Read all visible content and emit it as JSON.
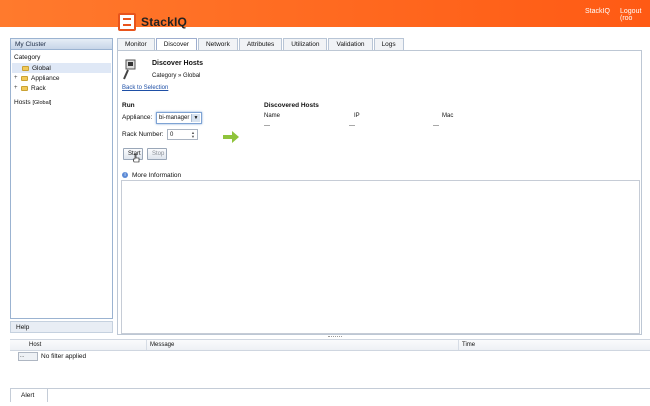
{
  "header": {
    "app_name": "StackIQ",
    "link_stackiq": "StackIQ",
    "link_logout": "Logout (roo"
  },
  "sidebar": {
    "title": "My Cluster",
    "category_label": "Category",
    "tree": [
      {
        "label": "Global",
        "selected": true
      },
      {
        "label": "Appliance",
        "expander": "+"
      },
      {
        "label": "Rack",
        "expander": "+"
      }
    ],
    "hosts_label": "Hosts",
    "hosts_scope": "[Global]",
    "help_label": "Help"
  },
  "tabs": [
    "Monitor",
    "Discover",
    "Network",
    "Attributes",
    "Utilization",
    "Validation",
    "Logs"
  ],
  "active_tab": "Discover",
  "discover": {
    "title": "Discover Hosts",
    "breadcrumb_category": "Category",
    "breadcrumb_sep": "»",
    "breadcrumb_value": "Global",
    "back_link": "Back to Selection",
    "run_label": "Run",
    "appliance_label": "Appliance:",
    "appliance_value": "bi-manager",
    "rack_label": "Rack Number:",
    "rack_value": "0",
    "start_button": "Start",
    "stop_button": "Stop",
    "discovered_title": "Discovered Hosts",
    "columns": [
      "Name",
      "IP",
      "Mac"
    ],
    "values": [
      "---",
      "---",
      "---"
    ],
    "more_info_label": "More Information"
  },
  "bottom_grid": {
    "columns": [
      "Host",
      "Message",
      "Time"
    ],
    "filter_button": "...",
    "filter_text": "No filter applied",
    "alert_tab": "Alert"
  },
  "colors": {
    "header_orange": "#ff6a1f",
    "link_blue": "#1e4fa6"
  }
}
